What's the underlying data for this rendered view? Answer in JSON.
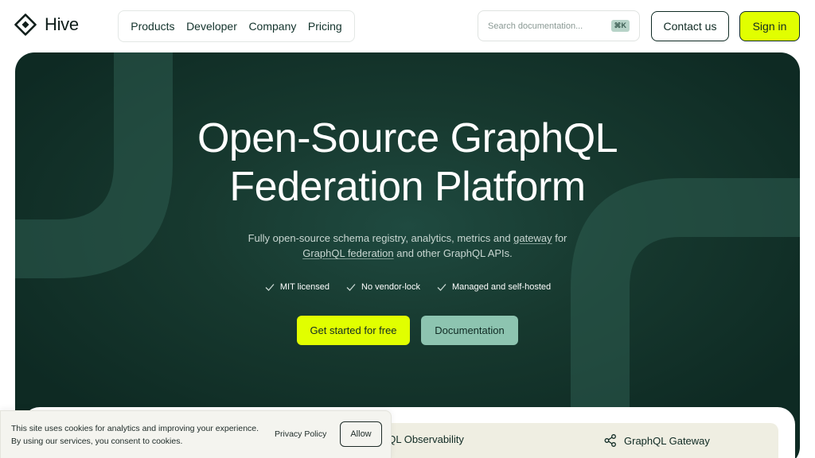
{
  "header": {
    "logo_text": "Hive",
    "nav": [
      "Products",
      "Developer",
      "Company",
      "Pricing"
    ],
    "search_placeholder": "Search documentation...",
    "search_shortcut": "⌘K",
    "contact_label": "Contact us",
    "signin_label": "Sign in"
  },
  "hero": {
    "title_line1": "Open-Source GraphQL",
    "title_line2": "Federation Platform",
    "subtitle_part1": "Fully open-source schema registry, analytics, metrics and ",
    "subtitle_link1": "gateway",
    "subtitle_part2": " for",
    "subtitle_link2": "GraphQL federation",
    "subtitle_part3": " and other GraphQL APIs.",
    "checks": [
      "MIT licensed",
      "No vendor-lock",
      "Managed and self-hosted"
    ],
    "cta_primary": "Get started for free",
    "cta_secondary": "Documentation"
  },
  "tabs": {
    "observability": "hQL Observability",
    "gateway": "GraphQL Gateway"
  },
  "cookie": {
    "line1": "This site uses cookies for analytics and improving your experience.",
    "line2": "By using our services, you consent to cookies.",
    "privacy_label": "Privacy Policy",
    "allow_label": "Allow"
  },
  "colors": {
    "accent": "#e1ff00",
    "hero_bg": "#17392f",
    "secondary_button": "#8dc4b0"
  },
  "icons": [
    "hive-logo-icon",
    "check-icon",
    "share-nodes-icon"
  ]
}
